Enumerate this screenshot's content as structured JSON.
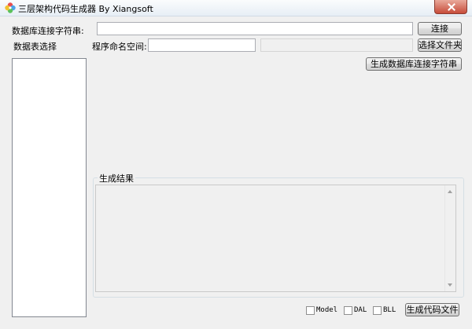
{
  "window": {
    "title": "三层架构代码生成器 By Xiangsoft"
  },
  "connection": {
    "label": "数据库连接字符串:",
    "value": "",
    "connect_button": "连接"
  },
  "tables": {
    "label": "数据表选择",
    "items": []
  },
  "namespace": {
    "label": "程序命名空间:",
    "value": "",
    "folder_path": "",
    "folder_button": "选择文件夹"
  },
  "generate_conn_button": "生成数据库连接字符串",
  "result": {
    "group_title": "生成结果",
    "text": ""
  },
  "options": {
    "model": "Model",
    "dal": "DAL",
    "bll": "BLL"
  },
  "generate_code_button": "生成代码文件"
}
